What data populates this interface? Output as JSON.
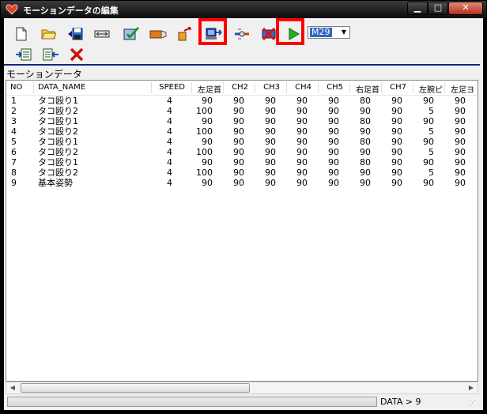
{
  "window": {
    "title": "モーションデータの編集",
    "min_glyph": "▁",
    "max_glyph": "□",
    "close_glyph": "✕"
  },
  "toolbar": {
    "combo_value": "M29"
  },
  "section": {
    "label": "モーションデータ"
  },
  "table": {
    "columns": [
      "NO",
      "DATA_NAME",
      "SPEED",
      "左足首",
      "CH2",
      "CH3",
      "CH4",
      "CH5",
      "右足首",
      "CH7",
      "左腕ピ",
      "左足ヨ"
    ],
    "rows": [
      {
        "no": "1",
        "name": "タコ殴り1",
        "speed": "4",
        "v": [
          "90",
          "90",
          "90",
          "90",
          "90",
          "80",
          "90",
          "90",
          "90"
        ]
      },
      {
        "no": "2",
        "name": "タコ殴り2",
        "speed": "4",
        "v": [
          "100",
          "90",
          "90",
          "90",
          "90",
          "90",
          "90",
          "5",
          "90"
        ]
      },
      {
        "no": "3",
        "name": "タコ殴り1",
        "speed": "4",
        "v": [
          "90",
          "90",
          "90",
          "90",
          "90",
          "80",
          "90",
          "90",
          "90"
        ]
      },
      {
        "no": "4",
        "name": "タコ殴り2",
        "speed": "4",
        "v": [
          "100",
          "90",
          "90",
          "90",
          "90",
          "90",
          "90",
          "5",
          "90"
        ]
      },
      {
        "no": "5",
        "name": "タコ殴り1",
        "speed": "4",
        "v": [
          "90",
          "90",
          "90",
          "90",
          "90",
          "80",
          "90",
          "90",
          "90"
        ]
      },
      {
        "no": "6",
        "name": "タコ殴り2",
        "speed": "4",
        "v": [
          "100",
          "90",
          "90",
          "90",
          "90",
          "90",
          "90",
          "5",
          "90"
        ]
      },
      {
        "no": "7",
        "name": "タコ殴り1",
        "speed": "4",
        "v": [
          "90",
          "90",
          "90",
          "90",
          "90",
          "80",
          "90",
          "90",
          "90"
        ]
      },
      {
        "no": "8",
        "name": "タコ殴り2",
        "speed": "4",
        "v": [
          "100",
          "90",
          "90",
          "90",
          "90",
          "90",
          "90",
          "5",
          "90"
        ]
      },
      {
        "no": "9",
        "name": "基本姿勢",
        "speed": "4",
        "v": [
          "90",
          "90",
          "90",
          "90",
          "90",
          "90",
          "90",
          "90",
          "90"
        ]
      }
    ]
  },
  "scrollbar": {
    "left_glyph": "◀",
    "right_glyph": "▶"
  },
  "status": {
    "text": "DATA > 9",
    "grip": "⋰"
  },
  "icons": {
    "toolbar_row1": [
      "new-file-icon",
      "open-folder-icon",
      "save-icon",
      "resize-icon",
      "edit-check-icon",
      "write-icon",
      "export-icon",
      "send-to-robot-icon",
      "connect-icon",
      "disconnect-icon",
      "play-icon"
    ],
    "toolbar_row2": [
      "insert-row-icon",
      "delete-row-icon",
      "close-x-icon"
    ]
  },
  "colors": {
    "highlight": "#ff0000",
    "accent": "#1a237e",
    "play": "#22b022"
  }
}
